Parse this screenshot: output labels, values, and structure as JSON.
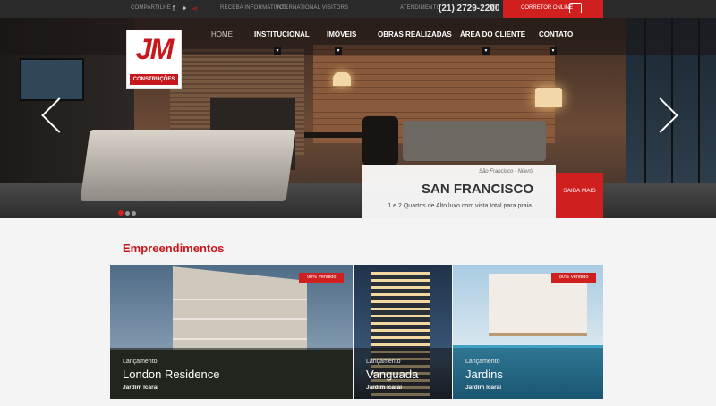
{
  "topbar": {
    "share_label": "COMPARTILHE",
    "links": [
      "RECEBA INFORMATIVOS",
      "INTERNATIONAL VISITORS"
    ],
    "atendimento_label": "ATENDIMENTO",
    "phone": "(21) 2729-2200",
    "corretor_label": "CORRETOR ONLINE"
  },
  "brand": {
    "logo_text": "JM",
    "logo_sub": "CONSTRUÇÕES",
    "accent": "#d01f1f"
  },
  "nav": {
    "items": [
      {
        "label": "HOME",
        "active": true
      },
      {
        "label": "INSTITUCIONAL"
      },
      {
        "label": "IMÓVEIS"
      },
      {
        "label": "OBRAS REALIZADAS"
      },
      {
        "label": "ÁREA DO CLIENTE"
      },
      {
        "label": "CONTATO"
      }
    ]
  },
  "slide": {
    "location": "São Francisco - Niterói",
    "title": "SAN FRANCISCO",
    "description": "1 e 2 Quartos de Alto luxo com vista total para praia.",
    "cta": "SAIBA MAIS",
    "active_dot": 1,
    "dot_count": 3
  },
  "section": {
    "title": "Empreendimentos"
  },
  "cards": [
    {
      "kind": "Lançamento",
      "name": "London Residence",
      "area": "Jardim Icaraí",
      "badge": "90% Vendido"
    },
    {
      "kind": "Lançamento",
      "name": "Vanguada",
      "area": "Jardim Icaraí",
      "badge": ""
    },
    {
      "kind": "Lançamento",
      "name": "Jardins",
      "area": "Jardim Icaraí",
      "badge": "80% Vendido"
    }
  ]
}
